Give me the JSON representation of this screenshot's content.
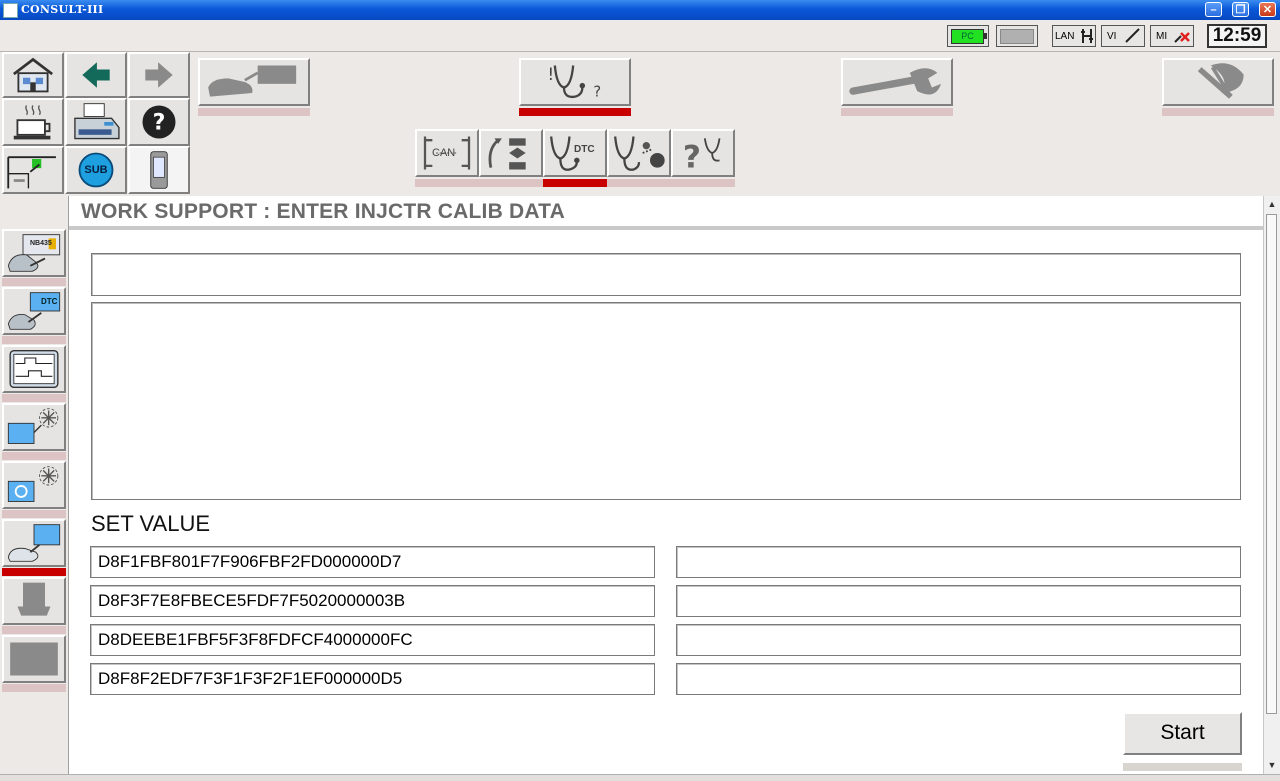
{
  "window": {
    "title": "CONSULT-III"
  },
  "status": {
    "pc_label": "PC",
    "lan_label": "LAN",
    "vi_label": "VI",
    "mi_label": "MI",
    "clock": "12:59"
  },
  "toolbar": {
    "sub_label": "SUB",
    "can_label": "CAN",
    "dtc_label": "DTC"
  },
  "sidebar": {
    "vehicle_label": "NB435",
    "dtc_label": "DTC"
  },
  "page": {
    "title": "WORK SUPPORT : ENTER INJCTR CALIB DATA",
    "set_value_label": "SET VALUE"
  },
  "set_values": [
    {
      "value": "D8F1FBF801F7F906FBF2FD000000D7",
      "entry": ""
    },
    {
      "value": "D8F3F7E8FBECE5FDF7F5020000003B",
      "entry": ""
    },
    {
      "value": "D8DEEBE1FBF5F3F8FDFCF4000000FC",
      "entry": ""
    },
    {
      "value": "D8F8F2EDF7F3F1F3F2F1EF000000D5",
      "entry": ""
    }
  ],
  "buttons": {
    "start": "Start"
  }
}
